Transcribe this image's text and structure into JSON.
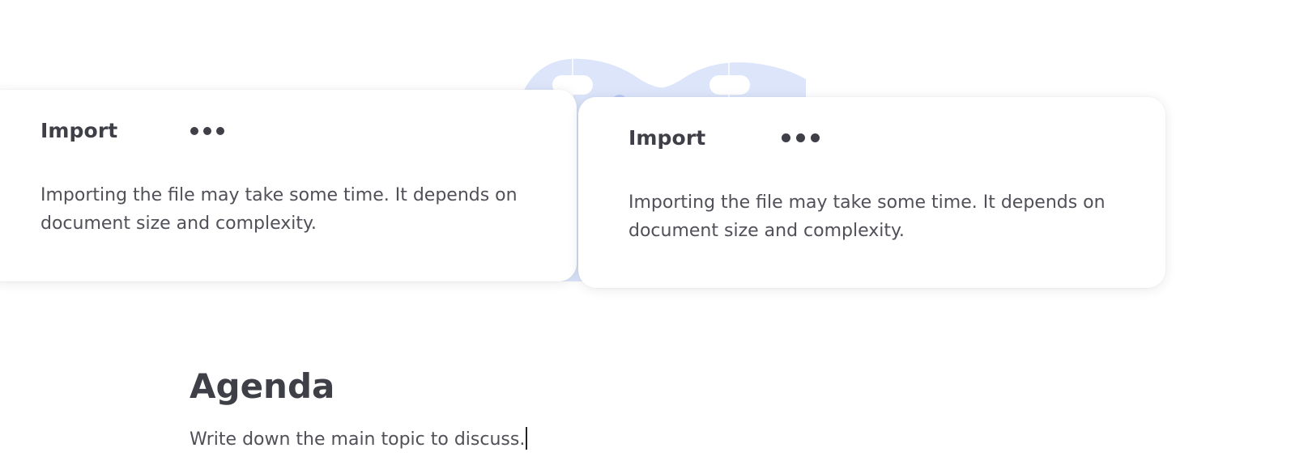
{
  "cards": [
    {
      "title": "Import",
      "more_icon": "more-horizontal-icon",
      "body": "Importing the file may take some time. It depends on document size and complexity."
    },
    {
      "title": "Import",
      "more_icon": "more-horizontal-icon",
      "body": "Importing the file may take some time. It depends on document size and complexity."
    }
  ],
  "document": {
    "heading": "Agenda",
    "text": "Write down the main topic to discuss."
  },
  "colors": {
    "text": "#3f3f48",
    "illustration": "#dde6fb",
    "background": "#ffffff"
  }
}
